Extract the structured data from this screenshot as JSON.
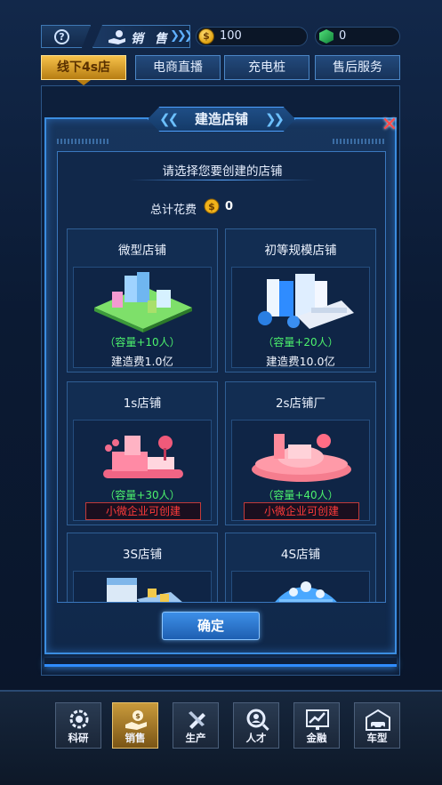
{
  "topbar": {
    "help_icon": "help-circle-icon",
    "section_label": "销 售",
    "coins": "100",
    "gems": "0",
    "colors": {
      "coin": "#f0b21a",
      "gem": "#2fb85a"
    }
  },
  "tabs": [
    {
      "label": "线下4s店",
      "active": true
    },
    {
      "label": "电商直播",
      "active": false
    },
    {
      "label": "充电桩",
      "active": false
    },
    {
      "label": "售后服务",
      "active": false
    }
  ],
  "dialog": {
    "title": "建造店铺",
    "prompt": "请选择您要创建的店铺",
    "cost_label": "总计花费",
    "cost_value": "0",
    "confirm_label": "确定",
    "close_icon": "close-x-icon"
  },
  "stores": [
    {
      "name": "微型店铺",
      "capacity": "（容量+10人）",
      "fee": "建造费1.0亿"
    },
    {
      "name": "初等规模店铺",
      "capacity": "（容量+20人）",
      "fee": "建造费10.0亿"
    },
    {
      "name": "1s店铺",
      "capacity": "（容量+30人）",
      "requirement": "小微企业可创建"
    },
    {
      "name": "2s店铺厂",
      "capacity": "（容量+40人）",
      "requirement": "小微企业可创建"
    },
    {
      "name": "3S店铺"
    },
    {
      "name": "4S店铺"
    }
  ],
  "nav": [
    {
      "label": "科研",
      "icon": "gear-research-icon",
      "active": false
    },
    {
      "label": "销售",
      "icon": "money-hand-icon",
      "active": true
    },
    {
      "label": "生产",
      "icon": "wrench-icon",
      "active": false
    },
    {
      "label": "人才",
      "icon": "person-search-icon",
      "active": false
    },
    {
      "label": "金融",
      "icon": "chart-icon",
      "active": false
    },
    {
      "label": "车型",
      "icon": "car-garage-icon",
      "active": false
    }
  ]
}
